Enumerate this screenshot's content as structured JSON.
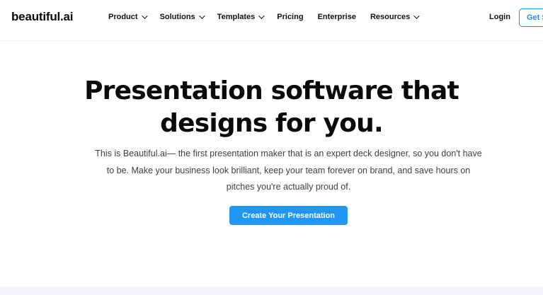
{
  "brand": {
    "logo_text": "beautiful.ai"
  },
  "nav": {
    "items": [
      {
        "label": "Product",
        "has_dropdown": true
      },
      {
        "label": "Solutions",
        "has_dropdown": true
      },
      {
        "label": "Templates",
        "has_dropdown": true
      },
      {
        "label": "Pricing",
        "has_dropdown": false
      },
      {
        "label": "Enterprise",
        "has_dropdown": false
      },
      {
        "label": "Resources",
        "has_dropdown": true
      }
    ],
    "login_label": "Login",
    "get_started_label": "Get St"
  },
  "hero": {
    "headline": "Presentation software that designs for you.",
    "subtext": "This is Beautiful.ai— the first presentation maker that is an expert deck designer, so you don't have to be. Make your business look brilliant, keep your team forever on brand, and save hours on pitches you're actually proud of.",
    "cta_label": "Create Your Presentation"
  },
  "colors": {
    "accent": "#2196f3",
    "outline_accent": "#2d8cf0",
    "footer_band": "#f3f5f9"
  }
}
